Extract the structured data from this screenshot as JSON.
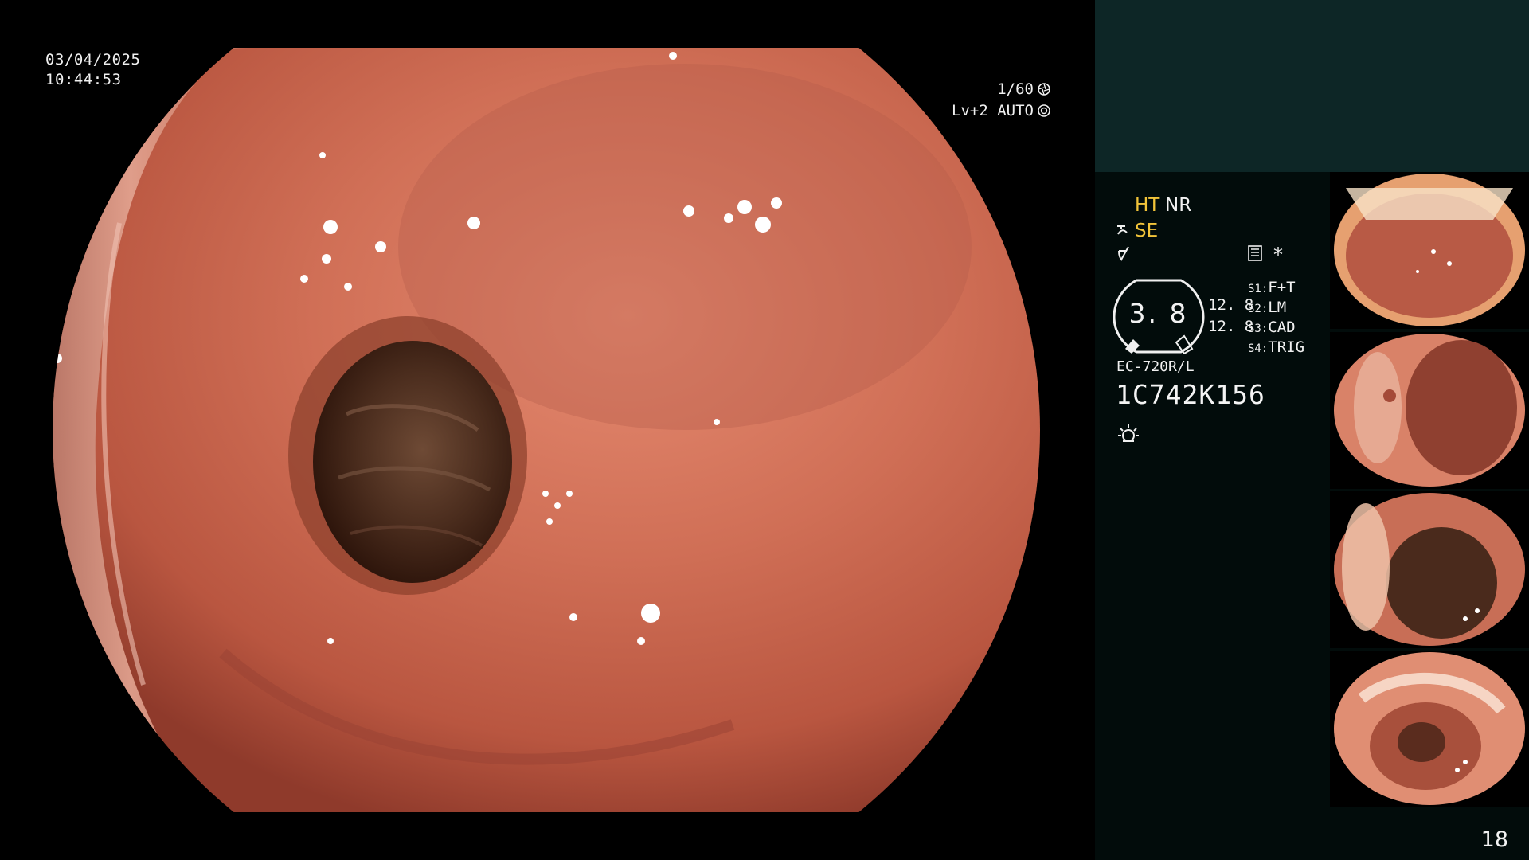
{
  "overlay": {
    "date": "03/04/2025",
    "time": "10:44:53",
    "shutter": "1/60",
    "exposure": "Lv+2 AUTO"
  },
  "side_panel": {
    "modes": {
      "ht": "HT",
      "nr": "NR",
      "se": "SE"
    },
    "gauge": {
      "value": "3. 8",
      "reading_1": "12. 8",
      "reading_2": "12. 8"
    },
    "switches": [
      {
        "key": "S1:",
        "value": "F+T"
      },
      {
        "key": "S2:",
        "value": "LM"
      },
      {
        "key": "S3:",
        "value": "CAD"
      },
      {
        "key": "S4:",
        "value": "TRIG"
      }
    ],
    "asterisk": "*",
    "scope_model": "EC-720R/L",
    "scope_serial": "1C742K156",
    "thumbnails": [
      {
        "name": "capture-1",
        "icon": "lumen-view"
      },
      {
        "name": "capture-2",
        "icon": "lumen-view"
      },
      {
        "name": "capture-3",
        "icon": "lumen-view"
      },
      {
        "name": "capture-4",
        "icon": "lumen-view"
      }
    ]
  },
  "page_number": "18",
  "colors": {
    "mucosa": "#c8664f",
    "mucosa_light": "#e79a7f",
    "lumen": "#3a1f14",
    "accent_yellow": "#f2c43a",
    "panel_top": "#0d2626",
    "panel_bg": "#020c0b"
  }
}
